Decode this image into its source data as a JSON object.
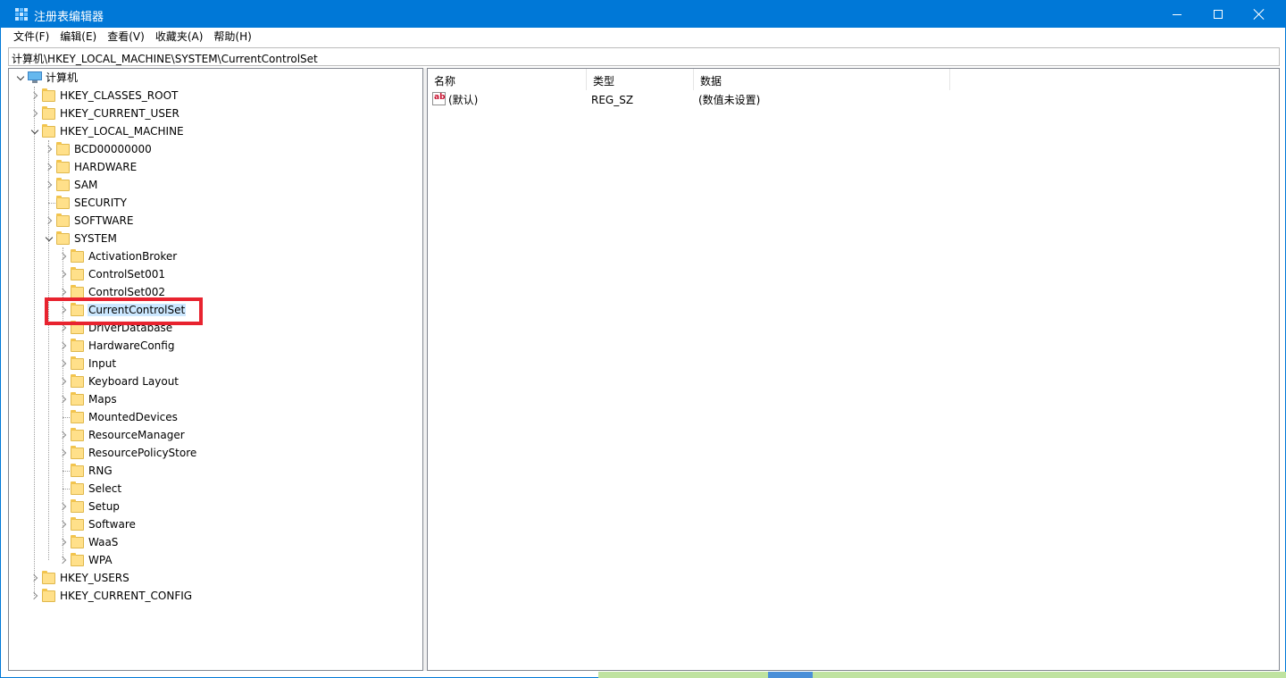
{
  "window": {
    "title": "注册表编辑器",
    "controls": {
      "minimize": "minimize-icon",
      "maximize": "maximize-icon",
      "close": "close-icon"
    }
  },
  "menu": [
    "文件(F)",
    "编辑(E)",
    "查看(V)",
    "收藏夹(A)",
    "帮助(H)"
  ],
  "address": "计算机\\HKEY_LOCAL_MACHINE\\SYSTEM\\CurrentControlSet",
  "tree": {
    "root": "计算机",
    "nodes": [
      "HKEY_CLASSES_ROOT",
      "HKEY_CURRENT_USER",
      "HKEY_LOCAL_MACHINE",
      "BCD00000000",
      "HARDWARE",
      "SAM",
      "SECURITY",
      "SOFTWARE",
      "SYSTEM",
      "ActivationBroker",
      "ControlSet001",
      "ControlSet002",
      "CurrentControlSet",
      "DriverDatabase",
      "HardwareConfig",
      "Input",
      "Keyboard Layout",
      "Maps",
      "MountedDevices",
      "ResourceManager",
      "ResourcePolicyStore",
      "RNG",
      "Select",
      "Setup",
      "Software",
      "WaaS",
      "WPA",
      "HKEY_USERS",
      "HKEY_CURRENT_CONFIG"
    ],
    "selected": "CurrentControlSet"
  },
  "list": {
    "columns": [
      "名称",
      "类型",
      "数据"
    ],
    "rows": [
      {
        "name": "(默认)",
        "type": "REG_SZ",
        "data": "(数值未设置)"
      }
    ]
  },
  "colors": {
    "titlebar": "#0078d7",
    "selection": "#cce8ff",
    "highlight_box": "#e8232f"
  }
}
